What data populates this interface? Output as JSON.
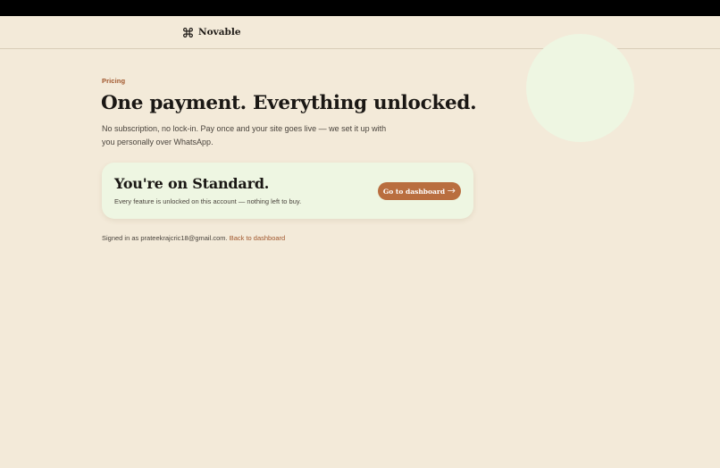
{
  "brand": {
    "name": "Novable",
    "icon": "command-icon"
  },
  "page": {
    "eyebrow": "Pricing",
    "headline": "One payment. Everything unlocked.",
    "subtext": "No subscription, no lock-in. Pay once and your site goes live — we set it up with you personally over WhatsApp."
  },
  "plan_card": {
    "title": "You're on Standard.",
    "note": "Every feature is unlocked on this account — nothing left to buy.",
    "button_label": "Go to dashboard",
    "button_icon": "arrow-right-icon"
  },
  "footer": {
    "signed_in_text": "Signed in as prateekrajcric18@gmail.com.",
    "back_link_label": "Back to dashboard"
  },
  "colors": {
    "background": "#f3ead9",
    "accent": "#b96e3f",
    "eyebrow": "#a0562c",
    "card": "#eef6e2"
  }
}
